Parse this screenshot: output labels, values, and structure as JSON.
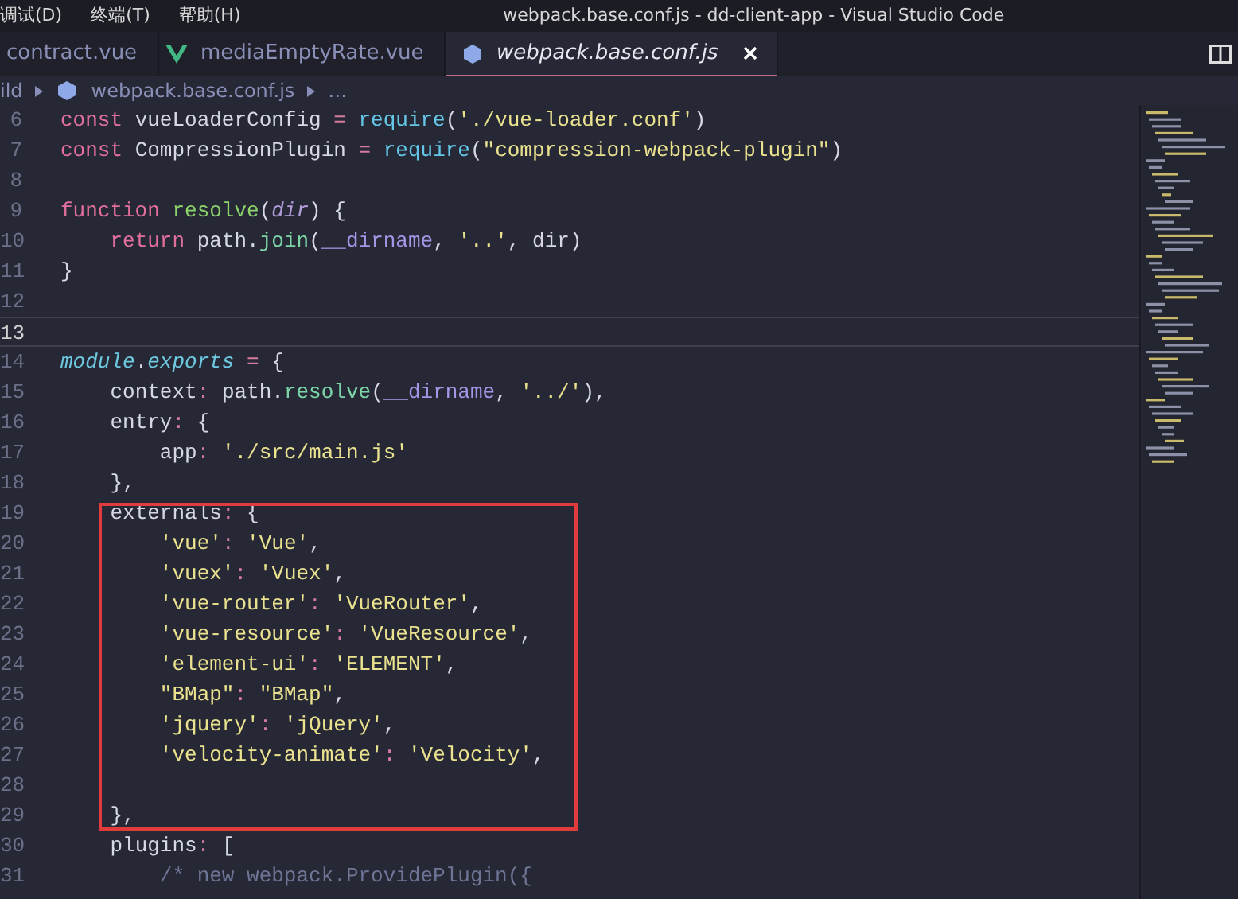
{
  "window": {
    "title": "webpack.base.conf.js - dd-client-app - Visual Studio Code"
  },
  "menu": [
    "调试(D)",
    "终端(T)",
    "帮助(H)"
  ],
  "tabs": [
    {
      "label": "contract.vue",
      "selected": false,
      "kind": "plain"
    },
    {
      "label": "mediaEmptyRate.vue",
      "selected": false,
      "kind": "vue"
    },
    {
      "label": "webpack.base.conf.js",
      "selected": true,
      "kind": "js"
    }
  ],
  "breadcrumb": [
    "ild",
    "webpack.base.conf.js",
    "…"
  ],
  "editor": {
    "lines": [
      {
        "number": "6",
        "current": false,
        "tokens": [
          {
            "kind": "kw",
            "t": "const"
          },
          {
            "kind": "plain",
            "t": " vueLoaderConfig "
          },
          {
            "kind": "punc",
            "t": "= "
          },
          {
            "kind": "req",
            "t": "require"
          },
          {
            "kind": "plain",
            "t": "("
          },
          {
            "kind": "str",
            "t": "'./vue-loader.conf'"
          },
          {
            "kind": "plain",
            "t": ")"
          }
        ]
      },
      {
        "number": "7",
        "current": false,
        "tokens": [
          {
            "kind": "kw",
            "t": "const"
          },
          {
            "kind": "plain",
            "t": " CompressionPlugin "
          },
          {
            "kind": "punc",
            "t": "= "
          },
          {
            "kind": "req",
            "t": "require"
          },
          {
            "kind": "plain",
            "t": "("
          },
          {
            "kind": "str",
            "t": "\"compression-webpack-plugin\""
          },
          {
            "kind": "plain",
            "t": ")"
          }
        ]
      },
      {
        "number": "8",
        "current": false
      },
      {
        "number": "9",
        "current": false,
        "tokens": [
          {
            "kind": "kw",
            "t": "function "
          },
          {
            "kind": "def",
            "t": "resolve"
          },
          {
            "kind": "plain",
            "t": "("
          },
          {
            "kind": "param",
            "t": "dir"
          },
          {
            "kind": "plain",
            "t": ") {"
          }
        ]
      },
      {
        "number": "10",
        "current": false,
        "tokens": [
          {
            "kind": "kw",
            "t": "    return"
          },
          {
            "kind": "plain",
            "t": " path."
          },
          {
            "kind": "call",
            "t": "join"
          },
          {
            "kind": "plain",
            "t": "("
          },
          {
            "kind": "builtin",
            "t": "__dirname"
          },
          {
            "kind": "plain",
            "t": ", "
          },
          {
            "kind": "str",
            "t": "'..'"
          },
          {
            "kind": "plain",
            "t": ", dir)"
          }
        ]
      },
      {
        "number": "11",
        "current": false,
        "tokens": [
          {
            "kind": "plain",
            "t": "}"
          }
        ]
      },
      {
        "number": "12",
        "current": false
      },
      {
        "number": "13",
        "current": true
      },
      {
        "number": "14",
        "current": false,
        "tokens": [
          {
            "kind": "module",
            "t": "module"
          },
          {
            "kind": "plain",
            "t": "."
          },
          {
            "kind": "module",
            "t": "exports"
          },
          {
            "kind": "punc",
            "t": " = "
          },
          {
            "kind": "plain",
            "t": "{"
          }
        ]
      },
      {
        "number": "15",
        "current": false,
        "tokens": [
          {
            "kind": "plain",
            "t": "    context"
          },
          {
            "kind": "punc",
            "t": ": "
          },
          {
            "kind": "plain",
            "t": "path."
          },
          {
            "kind": "call",
            "t": "resolve"
          },
          {
            "kind": "plain",
            "t": "("
          },
          {
            "kind": "builtin",
            "t": "__dirname"
          },
          {
            "kind": "plain",
            "t": ", "
          },
          {
            "kind": "str",
            "t": "'../'"
          },
          {
            "kind": "plain",
            "t": "),"
          }
        ]
      },
      {
        "number": "16",
        "current": false,
        "tokens": [
          {
            "kind": "plain",
            "t": "    entry"
          },
          {
            "kind": "punc",
            "t": ": "
          },
          {
            "kind": "plain",
            "t": "{"
          }
        ]
      },
      {
        "number": "17",
        "current": false,
        "tokens": [
          {
            "kind": "plain",
            "t": "        app"
          },
          {
            "kind": "punc",
            "t": ": "
          },
          {
            "kind": "str",
            "t": "'./src/main.js'"
          }
        ]
      },
      {
        "number": "18",
        "current": false,
        "tokens": [
          {
            "kind": "plain",
            "t": "    },"
          }
        ]
      },
      {
        "number": "19",
        "current": false,
        "tokens": [
          {
            "kind": "plain",
            "t": "    externals"
          },
          {
            "kind": "punc",
            "t": ": "
          },
          {
            "kind": "plain",
            "t": "{"
          }
        ]
      },
      {
        "number": "20",
        "current": false,
        "tokens": [
          {
            "kind": "str",
            "t": "        'vue'"
          },
          {
            "kind": "punc",
            "t": ": "
          },
          {
            "kind": "str",
            "t": "'Vue'"
          },
          {
            "kind": "plain",
            "t": ","
          }
        ]
      },
      {
        "number": "21",
        "current": false,
        "tokens": [
          {
            "kind": "str",
            "t": "        'vuex'"
          },
          {
            "kind": "punc",
            "t": ": "
          },
          {
            "kind": "str",
            "t": "'Vuex'"
          },
          {
            "kind": "plain",
            "t": ","
          }
        ]
      },
      {
        "number": "22",
        "current": false,
        "tokens": [
          {
            "kind": "str",
            "t": "        'vue-router'"
          },
          {
            "kind": "punc",
            "t": ": "
          },
          {
            "kind": "str",
            "t": "'VueRouter'"
          },
          {
            "kind": "plain",
            "t": ","
          }
        ]
      },
      {
        "number": "23",
        "current": false,
        "tokens": [
          {
            "kind": "str",
            "t": "        'vue-resource'"
          },
          {
            "kind": "punc",
            "t": ": "
          },
          {
            "kind": "str",
            "t": "'VueResource'"
          },
          {
            "kind": "plain",
            "t": ","
          }
        ]
      },
      {
        "number": "24",
        "current": false,
        "tokens": [
          {
            "kind": "str",
            "t": "        'element-ui'"
          },
          {
            "kind": "punc",
            "t": ": "
          },
          {
            "kind": "str",
            "t": "'ELEMENT'"
          },
          {
            "kind": "plain",
            "t": ","
          }
        ]
      },
      {
        "number": "25",
        "current": false,
        "tokens": [
          {
            "kind": "str",
            "t": "        \"BMap\""
          },
          {
            "kind": "punc",
            "t": ": "
          },
          {
            "kind": "str",
            "t": "\"BMap\""
          },
          {
            "kind": "plain",
            "t": ","
          }
        ]
      },
      {
        "number": "26",
        "current": false,
        "tokens": [
          {
            "kind": "str",
            "t": "        'jquery'"
          },
          {
            "kind": "punc",
            "t": ": "
          },
          {
            "kind": "str",
            "t": "'jQuery'"
          },
          {
            "kind": "plain",
            "t": ","
          }
        ]
      },
      {
        "number": "27",
        "current": false,
        "tokens": [
          {
            "kind": "str",
            "t": "        'velocity-animate'"
          },
          {
            "kind": "punc",
            "t": ": "
          },
          {
            "kind": "str",
            "t": "'Velocity'"
          },
          {
            "kind": "plain",
            "t": ","
          }
        ]
      },
      {
        "number": "28",
        "current": false
      },
      {
        "number": "29",
        "current": false,
        "tokens": [
          {
            "kind": "plain",
            "t": "    },"
          }
        ]
      },
      {
        "number": "30",
        "current": false,
        "tokens": [
          {
            "kind": "plain",
            "t": "    plugins"
          },
          {
            "kind": "punc",
            "t": ": "
          },
          {
            "kind": "plain",
            "t": "["
          }
        ]
      },
      {
        "number": "31",
        "current": false,
        "tokens": [
          {
            "kind": "comment",
            "t": "        /* new webpack.ProvidePlugin({"
          }
        ]
      }
    ]
  }
}
